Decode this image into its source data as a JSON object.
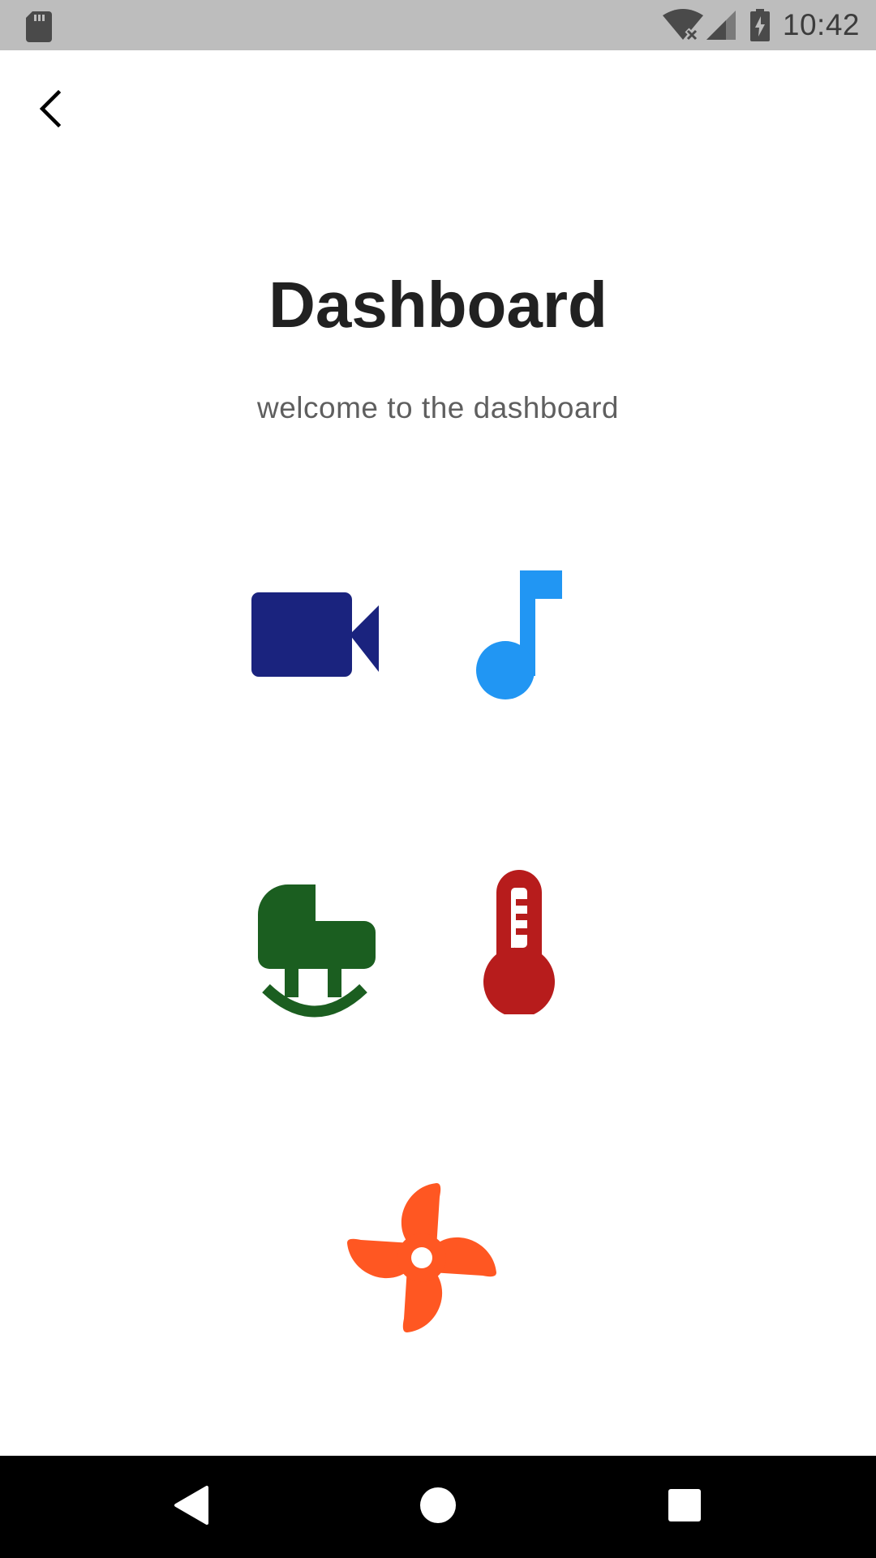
{
  "status_bar": {
    "time": "10:42",
    "icons": [
      "sd-card-icon",
      "wifi-off-icon",
      "cell-signal-icon",
      "battery-charging-icon"
    ]
  },
  "header": {
    "back_icon": "chevron-left-icon",
    "title": "Dashboard",
    "subtitle": "welcome to the dashboard"
  },
  "devices": [
    {
      "icon": "video-camera-icon",
      "color": "#1A237E"
    },
    {
      "icon": "music-note-icon",
      "color": "#2196F3"
    },
    {
      "icon": "rocking-horse-icon",
      "color": "#1B5E20"
    },
    {
      "icon": "thermometer-icon",
      "color": "#B71C1C"
    },
    {
      "icon": "fan-icon",
      "color": "#FF5722"
    }
  ],
  "nav_bar": {
    "icons": [
      "back-triangle-icon",
      "home-circle-icon",
      "recents-square-icon"
    ]
  }
}
